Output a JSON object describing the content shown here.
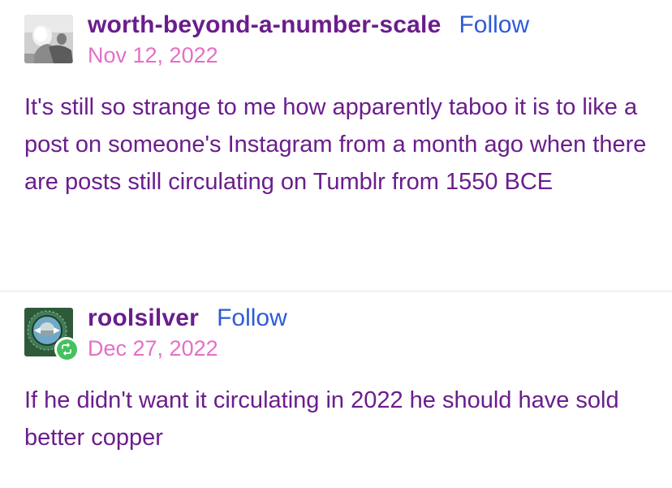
{
  "posts": [
    {
      "username": "worth-beyond-a-number-scale",
      "follow_label": "Follow",
      "date": "Nov 12, 2022",
      "body": "It's still so strange to me how apparently taboo it is to like a post on someone's Instagram from a month ago when there are posts still circulating on Tumblr from 1550 BCE",
      "avatar_icon": "grayscale-profile-photo"
    },
    {
      "username": "roolsilver",
      "follow_label": "Follow",
      "date": "Dec 27, 2022",
      "body": "If he didn't want it circulating in 2022 he should have sold better copper",
      "avatar_icon": "circular-emblem-profile-photo",
      "badge_icon": "reblog-icon"
    }
  ],
  "colors": {
    "username": "#6b1d8c",
    "follow": "#2e5bd6",
    "date": "#e56fc5",
    "body": "#6b1d8c",
    "reblog_badge": "#43c25f"
  }
}
